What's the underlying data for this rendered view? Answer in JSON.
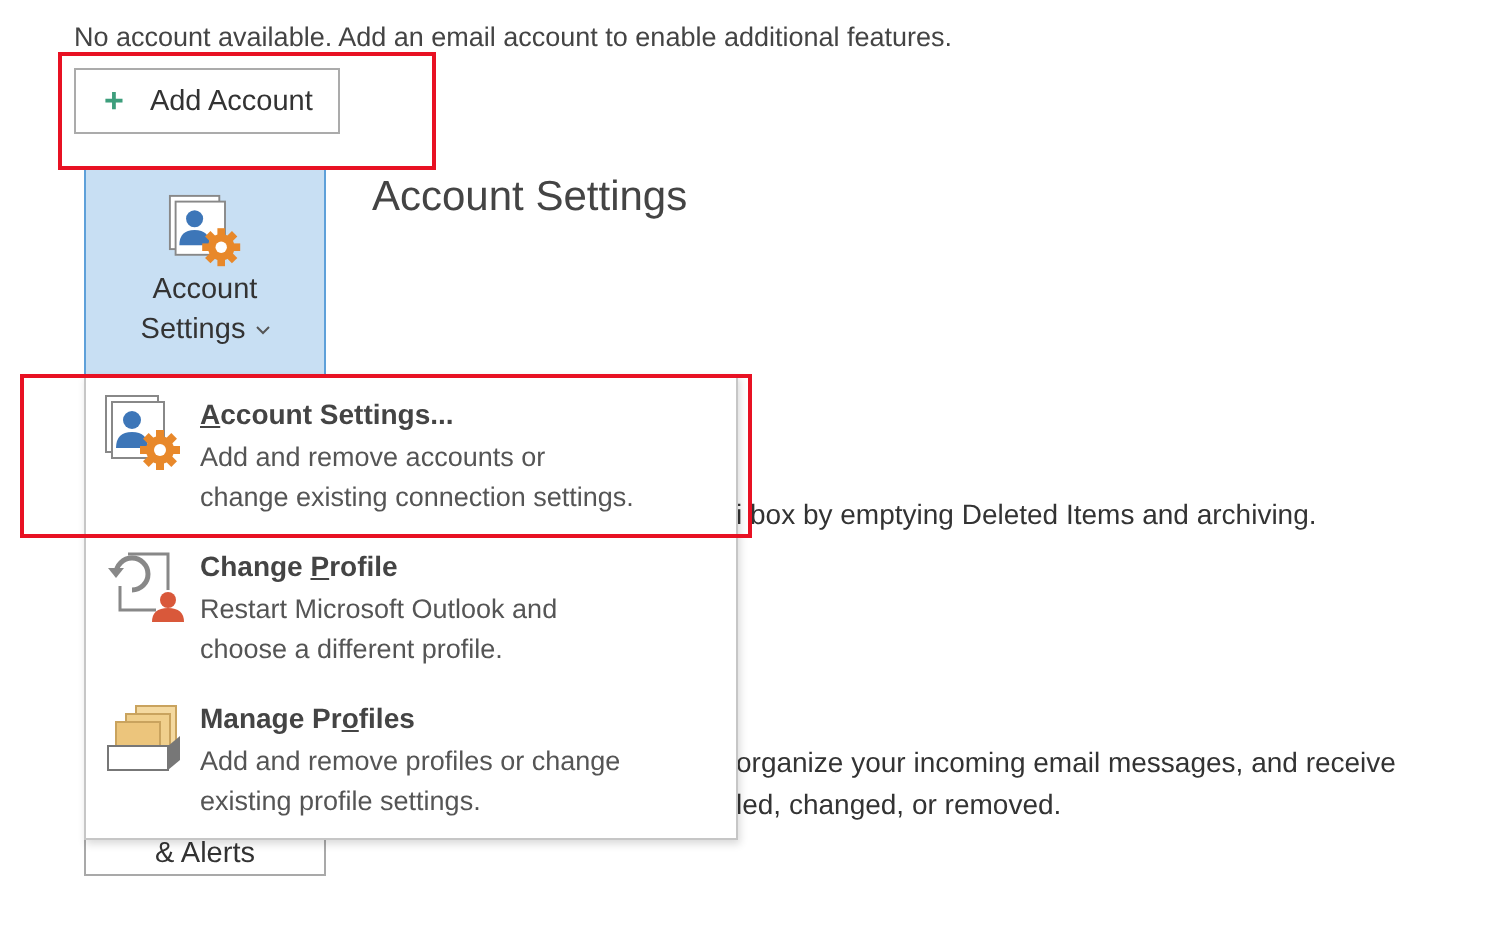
{
  "notice": "No account available. Add an email account to enable additional features.",
  "add_account": {
    "icon": "+",
    "label": "Add Account",
    "highlighted": true
  },
  "tiles": [
    {
      "kind": "dropdown",
      "line_1": "Account",
      "line_2": "Settings",
      "selected": true
    },
    {
      "kind": "plain",
      "line_1": "& Alerts",
      "selected": false
    }
  ],
  "heading": "Account Settings",
  "fragments": [
    {
      "text": "i box by emptying Deleted Items and archiving."
    },
    {
      "text": "organize your incoming email messages, and receive"
    },
    {
      "text": "led, changed, or removed."
    }
  ],
  "menu": {
    "items": [
      {
        "kind": "account",
        "access_key": "A",
        "title_after": "ccount Settings...",
        "description": [
          "Add and remove accounts or",
          "change existing connection settings."
        ],
        "highlighted": true
      },
      {
        "kind": "change",
        "title_before": "Change ",
        "access_key": "P",
        "title_after": "rofile",
        "description": [
          "Restart Microsoft Outlook and",
          "choose a different profile."
        ],
        "highlighted": false
      },
      {
        "kind": "manage",
        "title_before": "Manage Pr",
        "access_key": "o",
        "title_after": "files",
        "description": [
          "Add and remove profiles or change",
          "existing profile settings."
        ],
        "highlighted": false
      }
    ]
  }
}
